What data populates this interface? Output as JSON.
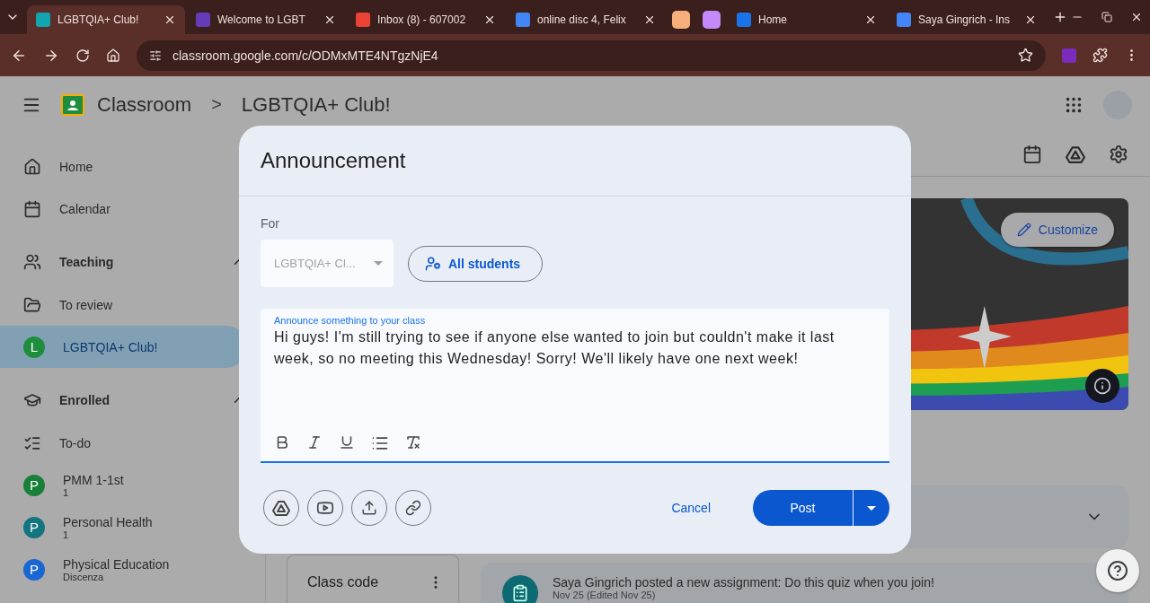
{
  "browser": {
    "tabs": [
      {
        "title": "LGBTQIA+ Club!",
        "selected": true,
        "color": "#12a4af"
      },
      {
        "title": "Welcome to LGBT",
        "selected": false,
        "color": "#673ab7"
      },
      {
        "title": "Inbox (8) - 607002",
        "selected": false,
        "color": "#ea4335"
      },
      {
        "title": "online disc 4, Felix",
        "selected": false,
        "color": "#4285f4"
      },
      {
        "selected": false,
        "color": "#f6ae7a"
      },
      {
        "selected": false,
        "color": "#c58af9"
      },
      {
        "title": "Home",
        "selected": false,
        "color": "#1a73e8"
      },
      {
        "title": "Saya Gingrich - Ins",
        "selected": false,
        "color": "#4285f4"
      }
    ],
    "address": "classroom.google.com/c/ODMxMTE4NTgzNjE4"
  },
  "header": {
    "app_name": "Classroom",
    "breadcrumb_separator": ">",
    "course": "LGBTQIA+ Club!"
  },
  "sidebar": {
    "items": [
      {
        "kind": "nav",
        "label": "Home",
        "selected": false
      },
      {
        "kind": "nav",
        "label": "Calendar",
        "selected": false
      },
      {
        "kind": "section",
        "label": "Teaching",
        "selected": false
      },
      {
        "kind": "nav",
        "label": "To review",
        "selected": false
      },
      {
        "kind": "class",
        "label": "LGBTQIA+ Club!",
        "letter": "L",
        "color": "#1e8e3e",
        "selected": true
      },
      {
        "kind": "section",
        "label": "Enrolled",
        "selected": false
      },
      {
        "kind": "nav",
        "label": "To-do",
        "selected": false
      },
      {
        "kind": "class",
        "label": "PMM 1-1st",
        "letter": "P",
        "subtitle": "1",
        "color": "#188038",
        "selected": false
      },
      {
        "kind": "class",
        "label": "Personal Health",
        "letter": "P",
        "subtitle": "1",
        "color": "#12757f",
        "selected": false
      },
      {
        "kind": "class",
        "label": "Physical Education",
        "letter": "P",
        "subtitle": "Discenza",
        "color": "#1967d2",
        "selected": false
      }
    ]
  },
  "stream": {
    "customize": "Customize",
    "class_code": "Class code",
    "post": {
      "title": "Saya Gingrich posted a new assignment: Do this quiz when you join!",
      "date": "Nov 25 (Edited Nov 25)"
    }
  },
  "dialog": {
    "title": "Announcement",
    "for_label": "For",
    "class_select": "LGBTQIA+ Cl...",
    "audience": "All students",
    "field_label": "Announce something to your class",
    "text": "Hi guys! I'm still trying to see if anyone else wanted to join but couldn't make it last week, so no meeting this Wednesday! Sorry! We'll likely have one next week!",
    "cancel": "Cancel",
    "post": "Post"
  }
}
